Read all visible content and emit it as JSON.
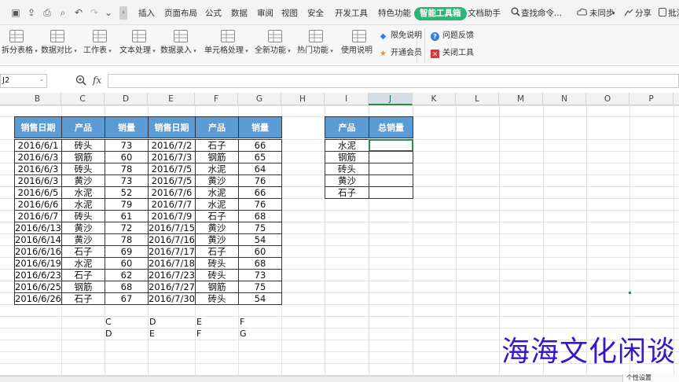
{
  "menubar": {
    "tabs": [
      "插入",
      "页面布局",
      "公式",
      "数据",
      "审阅",
      "视图",
      "安全",
      "开发工具",
      "特色功能",
      "智能工具箱",
      "文档助手"
    ],
    "active_tab": "智能工具箱",
    "search_label": "查找命令...",
    "cloud_label": "未同步",
    "share_label": "分享",
    "comment_label": "批注"
  },
  "ribbon": {
    "groups": [
      {
        "label": "拆分表格",
        "icon": "split-table-icon"
      },
      {
        "label": "数据对比",
        "icon": "data-compare-icon"
      },
      {
        "label": "工作表",
        "icon": "worksheet-icon"
      },
      {
        "label": "文本处理",
        "icon": "text-process-icon"
      },
      {
        "label": "数据录入",
        "icon": "data-entry-icon"
      },
      {
        "label": "单元格处理",
        "icon": "cell-process-icon"
      },
      {
        "label": "全新功能",
        "icon": "new-feature-icon"
      },
      {
        "label": "热门功能",
        "icon": "hot-feature-icon"
      },
      {
        "label": "使用说明",
        "icon": "usage-icon"
      }
    ],
    "side": [
      {
        "label": "限免说明",
        "icon": "tag-icon",
        "color": "#3b7ddd"
      },
      {
        "label": "开通会员",
        "icon": "crown-icon",
        "color": "#e8912a"
      },
      {
        "label": "问题反馈",
        "icon": "question-icon",
        "color": "#3b7ddd"
      },
      {
        "label": "关闭工具",
        "icon": "close-icon",
        "color": "#d9363e"
      }
    ]
  },
  "formula_bar": {
    "namebox": "J2",
    "fx": "fx",
    "value": ""
  },
  "columns": [
    "B",
    "C",
    "D",
    "E",
    "F",
    "G",
    "H",
    "I",
    "J",
    "K",
    "L",
    "M",
    "N",
    "O",
    "P"
  ],
  "selected_column": "J",
  "table1": {
    "headers": [
      "销售日期",
      "产品",
      "销量",
      "销售日期",
      "产品",
      "销量"
    ],
    "rows": [
      [
        "2016/6/1",
        "砖头",
        "73",
        "2016/7/2",
        "石子",
        "66"
      ],
      [
        "2016/6/3",
        "钢筋",
        "60",
        "2016/7/3",
        "钢筋",
        "65"
      ],
      [
        "2016/6/3",
        "砖头",
        "78",
        "2016/7/5",
        "水泥",
        "64"
      ],
      [
        "2016/6/3",
        "黄沙",
        "73",
        "2016/7/5",
        "黄沙",
        "76"
      ],
      [
        "2016/6/5",
        "水泥",
        "52",
        "2016/7/6",
        "水泥",
        "66"
      ],
      [
        "2016/6/6",
        "水泥",
        "79",
        "2016/7/7",
        "水泥",
        "76"
      ],
      [
        "2016/6/7",
        "砖头",
        "61",
        "2016/7/9",
        "石子",
        "68"
      ],
      [
        "2016/6/13",
        "黄沙",
        "72",
        "2016/7/15",
        "黄沙",
        "75"
      ],
      [
        "2016/6/14",
        "黄沙",
        "78",
        "2016/7/16",
        "黄沙",
        "54"
      ],
      [
        "2016/6/16",
        "石子",
        "69",
        "2016/7/17",
        "石子",
        "60"
      ],
      [
        "2016/6/19",
        "水泥",
        "60",
        "2016/7/18",
        "砖头",
        "68"
      ],
      [
        "2016/6/23",
        "石子",
        "62",
        "2016/7/23",
        "砖头",
        "73"
      ],
      [
        "2016/6/25",
        "钢筋",
        "68",
        "2016/7/27",
        "钢筋",
        "75"
      ],
      [
        "2016/6/26",
        "石子",
        "67",
        "2016/7/30",
        "砖头",
        "54"
      ]
    ]
  },
  "table2": {
    "headers": [
      "产品",
      "总销量"
    ],
    "products": [
      "水泥",
      "钢筋",
      "砖头",
      "黄沙",
      "石子"
    ]
  },
  "helper_rows": [
    [
      "C",
      "D",
      "E",
      "F"
    ],
    [
      "D",
      "E",
      "F",
      "G"
    ]
  ],
  "watermark": "海海文化闲谈",
  "status": {
    "label": "个性设置"
  },
  "colors": {
    "header_fill": "#5b9bd5",
    "accent": "#2bb673",
    "selected_border": "#2a8a4a"
  }
}
